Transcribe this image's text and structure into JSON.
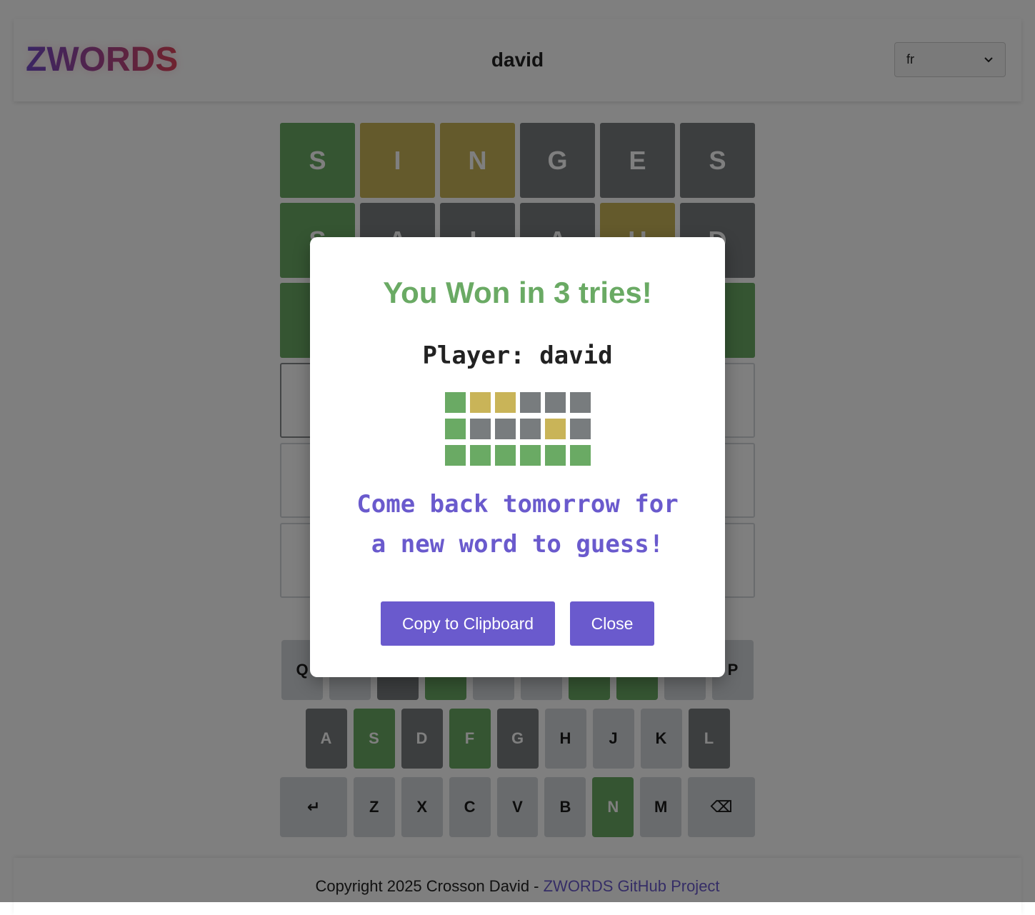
{
  "header": {
    "logo": "ZWORDS",
    "player": "david",
    "language": "fr"
  },
  "board": [
    [
      {
        "l": "S",
        "s": "correct"
      },
      {
        "l": "I",
        "s": "present"
      },
      {
        "l": "N",
        "s": "present"
      },
      {
        "l": "G",
        "s": "absent"
      },
      {
        "l": "E",
        "s": "absent"
      },
      {
        "l": "S",
        "s": "absent"
      }
    ],
    [
      {
        "l": "S",
        "s": "correct"
      },
      {
        "l": "A",
        "s": "absent"
      },
      {
        "l": "L",
        "s": "absent"
      },
      {
        "l": "A",
        "s": "absent"
      },
      {
        "l": "U",
        "s": "present"
      },
      {
        "l": "D",
        "s": "absent"
      }
    ],
    [
      {
        "l": "",
        "s": "correct"
      },
      {
        "l": "",
        "s": "correct"
      },
      {
        "l": "",
        "s": "correct"
      },
      {
        "l": "",
        "s": "correct"
      },
      {
        "l": "",
        "s": "correct"
      },
      {
        "l": "",
        "s": "correct"
      }
    ],
    [
      {
        "l": "",
        "s": "active"
      },
      {
        "l": "",
        "s": "empty"
      },
      {
        "l": "",
        "s": "empty"
      },
      {
        "l": "",
        "s": "empty"
      },
      {
        "l": "",
        "s": "empty"
      },
      {
        "l": "",
        "s": "empty"
      }
    ],
    [
      {
        "l": "",
        "s": "empty"
      },
      {
        "l": "",
        "s": "empty"
      },
      {
        "l": "",
        "s": "empty"
      },
      {
        "l": "",
        "s": "empty"
      },
      {
        "l": "",
        "s": "empty"
      },
      {
        "l": "",
        "s": "empty"
      }
    ],
    [
      {
        "l": "",
        "s": "empty"
      },
      {
        "l": "",
        "s": "empty"
      },
      {
        "l": "",
        "s": "empty"
      },
      {
        "l": "",
        "s": "empty"
      },
      {
        "l": "",
        "s": "empty"
      },
      {
        "l": "",
        "s": "empty"
      }
    ]
  ],
  "keyboard": [
    [
      {
        "k": "Q",
        "s": ""
      },
      {
        "k": "",
        "s": ""
      },
      {
        "k": "",
        "s": "absent"
      },
      {
        "k": "",
        "s": "correct"
      },
      {
        "k": "",
        "s": ""
      },
      {
        "k": "",
        "s": ""
      },
      {
        "k": "",
        "s": "correct"
      },
      {
        "k": "",
        "s": "correct"
      },
      {
        "k": "",
        "s": ""
      },
      {
        "k": "P",
        "s": ""
      }
    ],
    [
      {
        "k": "A",
        "s": "absent"
      },
      {
        "k": "S",
        "s": "correct"
      },
      {
        "k": "D",
        "s": "absent"
      },
      {
        "k": "F",
        "s": "correct"
      },
      {
        "k": "G",
        "s": "absent"
      },
      {
        "k": "H",
        "s": ""
      },
      {
        "k": "J",
        "s": ""
      },
      {
        "k": "K",
        "s": ""
      },
      {
        "k": "L",
        "s": "absent"
      }
    ],
    [
      {
        "k": "↵",
        "s": "",
        "wide": true,
        "name": "enter-key"
      },
      {
        "k": "Z",
        "s": ""
      },
      {
        "k": "X",
        "s": ""
      },
      {
        "k": "C",
        "s": ""
      },
      {
        "k": "V",
        "s": ""
      },
      {
        "k": "B",
        "s": ""
      },
      {
        "k": "N",
        "s": "correct"
      },
      {
        "k": "M",
        "s": ""
      },
      {
        "k": "⌫",
        "s": "",
        "wide": true,
        "name": "backspace-key"
      }
    ]
  ],
  "footer": {
    "text": "Copyright 2025 Crosson David - ",
    "link": "ZWORDS GitHub Project"
  },
  "modal": {
    "title": "You Won in 3 tries!",
    "player": "Player: david",
    "grid": [
      [
        "correct",
        "present",
        "present",
        "absent",
        "absent",
        "absent"
      ],
      [
        "correct",
        "absent",
        "absent",
        "absent",
        "present",
        "absent"
      ],
      [
        "correct",
        "correct",
        "correct",
        "correct",
        "correct",
        "correct"
      ]
    ],
    "message_line1": "Come back tomorrow for",
    "message_line2": "a new word to guess!",
    "copy_label": "Copy to Clipboard",
    "close_label": "Close"
  },
  "colors": {
    "correct": "#6aaa64",
    "present": "#c9b458",
    "absent": "#787c7e",
    "accent": "#6a5acd"
  }
}
